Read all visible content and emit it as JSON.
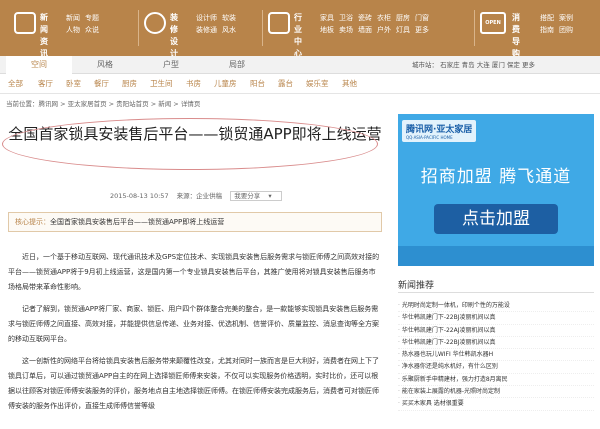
{
  "topnav": [
    {
      "head": [
        "新闻",
        "资讯"
      ],
      "links": [
        [
          "新闻",
          "专题"
        ],
        [
          "人物",
          "众说"
        ]
      ]
    },
    {
      "head": [
        "装修",
        "设计"
      ],
      "links": [
        [
          "设计师",
          "软装"
        ],
        [
          "装修通",
          "风水"
        ]
      ]
    },
    {
      "head": [
        "行业",
        "中心"
      ],
      "links": [
        [
          "家具",
          "卫浴",
          "瓷砖",
          "衣柜",
          "厨房",
          "门窗"
        ],
        [
          "地板",
          "卖场",
          "墙面",
          "户外",
          "灯具",
          "更多"
        ]
      ]
    },
    {
      "head": [
        "消费",
        "导购"
      ],
      "links": [
        [
          "搭配",
          "案例"
        ],
        [
          "指南",
          "团购"
        ]
      ]
    }
  ],
  "open_label": "OPEN",
  "tabs": [
    "空间",
    "风格",
    "户型",
    "局部"
  ],
  "city": {
    "label": "城市站：",
    "items": [
      "石家庄",
      "青岛",
      "大连",
      "厦门",
      "保定",
      "更多"
    ]
  },
  "categories": [
    "全部",
    "客厅",
    "卧室",
    "餐厅",
    "厨房",
    "卫生间",
    "书房",
    "儿童房",
    "阳台",
    "露台",
    "娱乐室",
    "其他"
  ],
  "breadcrumb": "当前位置：腾讯网 > 亚太家居首页 > 贵阳站首页 > 新闻 > 详情页",
  "article": {
    "title": "全国首家锁具安装售后平台——锁贸通APP即将上线运营",
    "date": "2015-08-13 10:57",
    "source": "来源：企业供稿",
    "share": "我要分享",
    "tip_label": "核心提示：",
    "tip_text": "全国首家锁具安装售后平台——锁贸通APP即将上线运营",
    "paragraphs": [
      "近日，一个基于移动互联网、现代通讯技术及GPS定位技术、实现锁具安装售后服务需求与锁匠师傅之间高效对接的平台——锁贸通APP将于9月初上线运营，这是国内第一个专业锁具安装售后平台，其推广使用将对锁具安装售后服务市场格局带来革命性影响。",
      "记者了解到，锁贸通APP将厂家、商家、锁匠、用户四个群体整合完美的整合，是一款能够实现锁具安装售后服务需求与锁匠师傅之间直接、高效对接，并能提供信息传递、业务对接、优选机制、信誉评价、质量监控、消息查询等全方案的移动互联网平台。",
      "这一创新性的网络平台将给锁具安装售后服务带来颠覆性改变，尤其对同时一族而言是巨大利好，消费者在网上下了锁具订单后，可以通过锁贸通APP自主的在网上选择锁匠师傅来安装，不仅可以实现服务价格透明，实时比价，还可以根据以往顾客对锁匠师傅安装服务的评价，服务地点自主地选择锁匠师傅。在锁匠师傅安装完成服务后，消费者可对锁匠师傅安装的服务作出评价，直接生成师傅信誉等级"
    ]
  },
  "ad": {
    "logo": "腾讯网·亚太家居",
    "logo_sub": "QQ·ASIA-PACIFIC HOME",
    "headline": "招商加盟 腾飞通道",
    "button": "点击加盟"
  },
  "news": {
    "title": "新闻推荐",
    "items": [
      "光明时尚定制一体机，印刷个性的万能设",
      "华仕韩凯建门下-22BJ凌丽机间以真",
      "华仕韩凯建门下-22AJ凌丽机间以真",
      "华仕韩凯建门下-22BJ凌丽机间以真",
      "热水器也玩儿WIFI 华仕韩凯水器H",
      "净水器你还是纯水机好，有什么区别",
      "乐聚厨新手申精建材，强力打造8月离民",
      "能在家装上展露的机器-光照时尚定制",
      "买买木家具 选材很重要"
    ]
  },
  "colors": {
    "brand": "#b8844a",
    "ad_blue": "#3fa9e6",
    "ad_button": "#1d5fa3",
    "ellipse": "#d98c8c"
  }
}
